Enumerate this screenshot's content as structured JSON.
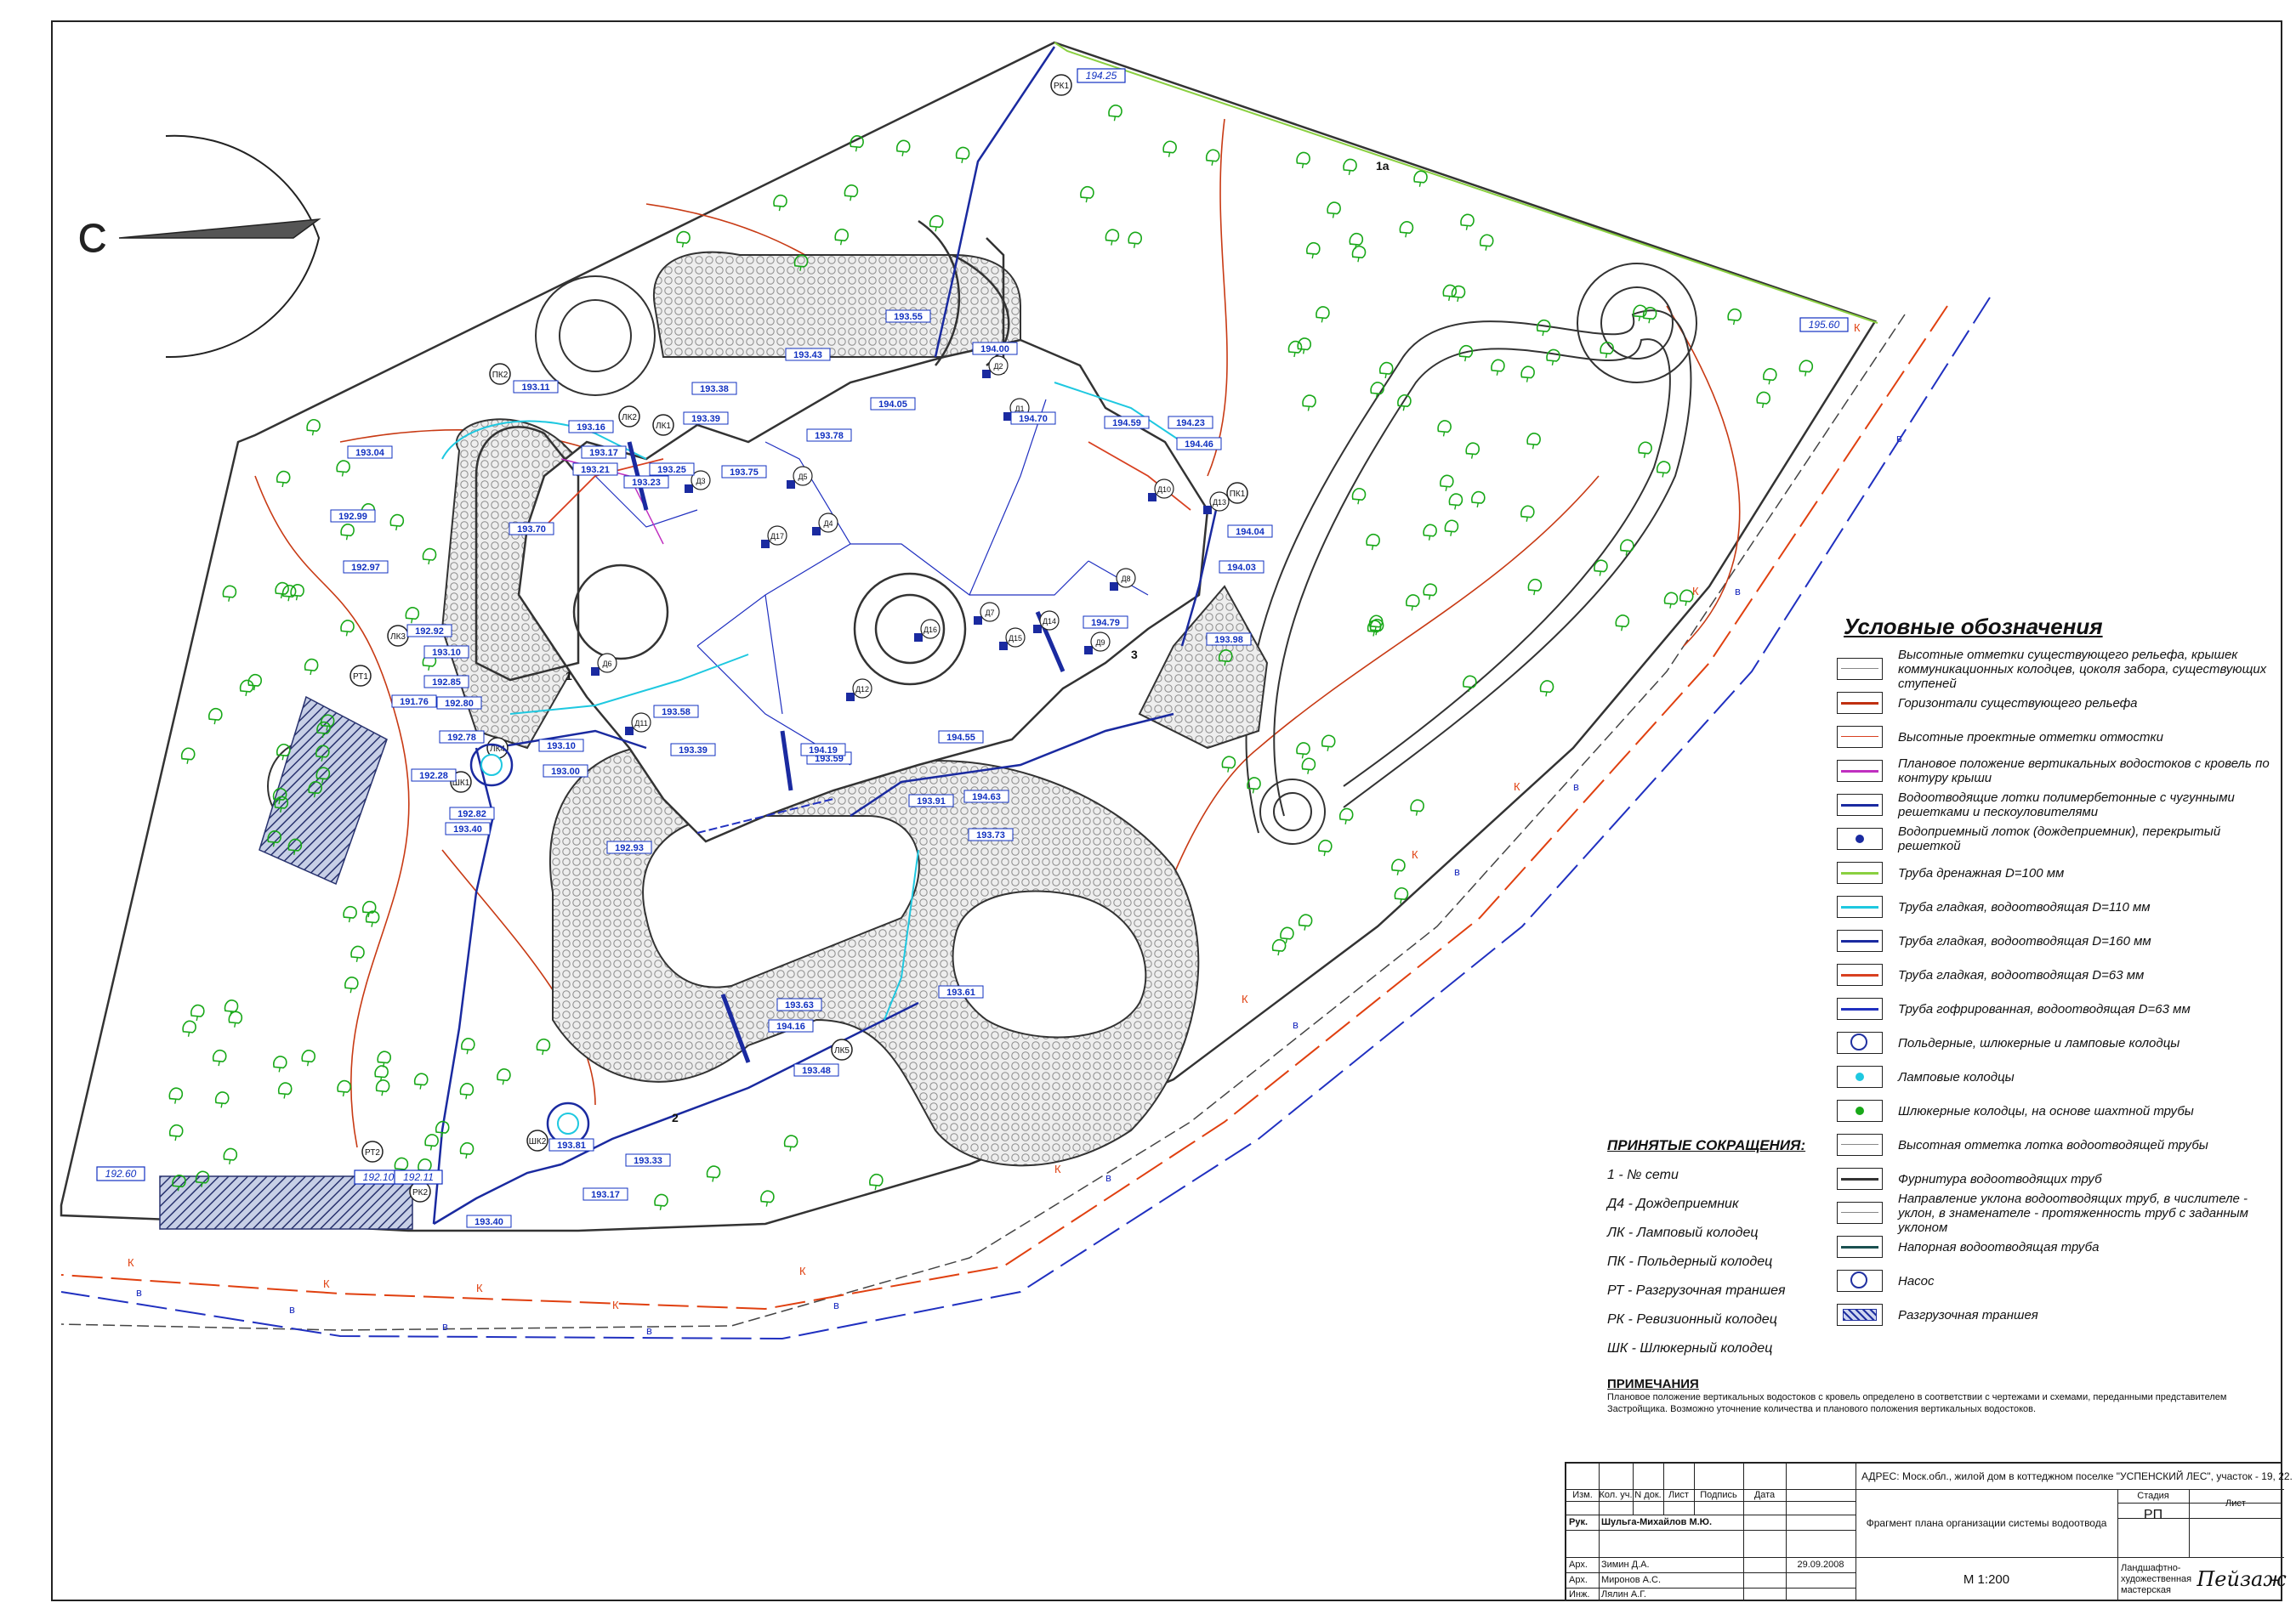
{
  "north_label": "С",
  "legend": {
    "title": "Условные обозначения",
    "items": [
      {
        "symbol": "existing-mark",
        "label": "Высотные отметки существующего рельефа, крышек коммуникационных колодцев, цоколя забора, существующих ступеней"
      },
      {
        "symbol": "contour",
        "label": "Горизонтали существующего рельефа"
      },
      {
        "symbol": "design-mark",
        "label": "Высотные проектные отметки отмостки"
      },
      {
        "symbol": "downspout",
        "label": "Плановое положение вертикальных водостоков с кровель по контуру крыши"
      },
      {
        "symbol": "channel",
        "label": "Водоотводящие лотки полимербетонные с чугунными решетками и пескоуловителями"
      },
      {
        "symbol": "inlet",
        "label": "Водоприемный лоток (дождеприемник), перекрытый решеткой"
      },
      {
        "symbol": "drain-pipe",
        "label": "Труба дренажная D=100 мм"
      },
      {
        "symbol": "pipe-110",
        "label": "Труба гладкая, водоотводящая D=110 мм"
      },
      {
        "symbol": "pipe-160",
        "label": "Труба гладкая, водоотводящая D=160 мм"
      },
      {
        "symbol": "pipe-63",
        "label": "Труба гладкая, водоотводящая D=63 мм"
      },
      {
        "symbol": "corrugated-63",
        "label": "Труба гофрированная, водоотводящая D=63 мм"
      },
      {
        "symbol": "well",
        "label": "Польдерные, шлюкерные и ламповые колодцы"
      },
      {
        "symbol": "lamp-well",
        "label": "Ламповые колодцы"
      },
      {
        "symbol": "sluice-well",
        "label": "Шлюкерные колодцы, на основе шахтной трубы"
      },
      {
        "symbol": "tray-mark",
        "label": "Высотная отметка лотка водоотводящей трубы"
      },
      {
        "symbol": "fittings",
        "label": "Фурнитура водоотводящих труб"
      },
      {
        "symbol": "slope",
        "label": "Направление уклона водоотводящих труб, в числителе - уклон, в знаменателе - протяженность труб с заданным уклоном"
      },
      {
        "symbol": "pressure-pipe",
        "label": "Напорная водоотводящая труба"
      },
      {
        "symbol": "pump",
        "label": "Насос"
      },
      {
        "symbol": "trench",
        "label": "Разгрузочная траншея"
      }
    ]
  },
  "abbreviations": {
    "title": "ПРИНЯТЫЕ СОКРАЩЕНИЯ:",
    "items": [
      "1 - № сети",
      "Д4 - Дождеприемник",
      "ЛК - Ламповый колодец",
      "ПК - Польдерный колодец",
      "РТ - Разгрузочная траншея",
      "РК - Ревизионный колодец",
      "ШК - Шлюкерный колодец"
    ]
  },
  "notes": {
    "title": "ПРИМЕЧАНИЯ",
    "text": "Плановое положение вертикальных водостоков с кровель определено в соответствии с чертежами и схемами, переданными представителем Застройщика. Возможно уточнение количества и планового положения вертикальных водостоков."
  },
  "title_block": {
    "head": [
      "Изм.",
      "Кол. уч.",
      "N док.",
      "Лист",
      "Подпись",
      "Дата"
    ],
    "address_label": "АДРЕС:",
    "address": "Моск.обл., жилой дом в коттеджном поселке \"УСПЕНСКИЙ ЛЕС\", участок - 19, 22.",
    "drawing_title": "Фрагмент плана организации системы водоотвода",
    "stage_label": "Стадия",
    "sheet_label": "Лист",
    "stage": "РП",
    "scale": "М 1:200",
    "studio": "Ландшафтно- художественная мастерская",
    "logo": "Пейзаж",
    "people": [
      {
        "role": "Рук.",
        "name": "Шульга-Михайлов М.Ю.",
        "date": ""
      },
      {
        "role": "Арх.",
        "name": "Зимин Д.А.",
        "date": "29.09.2008"
      },
      {
        "role": "Арх.",
        "name": "Миронов А.С.",
        "date": ""
      },
      {
        "role": "Инж.",
        "name": "Лялин А.Г.",
        "date": ""
      }
    ]
  },
  "plan": {
    "wells": [
      "РК1",
      "ПК2",
      "ЛК1",
      "ЛК2",
      "ЛК3",
      "ЛК4",
      "ЛК5",
      "ШК1",
      "ШК2",
      "РТ1",
      "РТ2",
      "РК2",
      "ПК1"
    ],
    "inlets": [
      "Д1",
      "Д2",
      "Д3",
      "Д4",
      "Д5",
      "Д6",
      "Д7",
      "Д8",
      "Д9",
      "Д10",
      "Д11",
      "Д12",
      "Д13",
      "Д14",
      "Д15",
      "Д16",
      "Д17"
    ],
    "network_labels": [
      "1",
      "2",
      "3",
      "1a"
    ],
    "boundary_marks": [
      "194.25",
      "195.60",
      "192.60",
      "192.10",
      "192.11"
    ],
    "design_marks": [
      "193.11",
      "193.16",
      "193.17",
      "193.21",
      "193.23",
      "193.25",
      "193.04",
      "192.99",
      "192.97",
      "192.92",
      "193.10",
      "192.85",
      "191.76",
      "192.78",
      "192.28",
      "192.82",
      "192.80",
      "193.10",
      "193.00",
      "193.40",
      "193.70",
      "193.38",
      "193.43",
      "193.55",
      "193.78",
      "193.75",
      "193.39",
      "194.00",
      "194.05",
      "194.70",
      "194.59",
      "194.23",
      "194.46",
      "194.04",
      "194.03",
      "193.98",
      "194.79",
      "193.58",
      "193.39",
      "193.59",
      "194.19",
      "194.55",
      "194.63",
      "193.91",
      "193.73",
      "193.61",
      "193.63",
      "194.16",
      "193.48",
      "193.81",
      "193.33",
      "193.17",
      "193.40",
      "192.93"
    ],
    "utility_letters": [
      "К",
      "в"
    ]
  },
  "colors": {
    "pipe_110": "#1ec8e0",
    "pipe_160": "#1a2aa0",
    "pipe_63": "#d84020",
    "corrugated": "#2030c0",
    "drain": "#8ad040",
    "contour": "#c03010",
    "tree": "#18a818",
    "design_mark": "#1030c0",
    "paving": "#d8d8d8"
  }
}
